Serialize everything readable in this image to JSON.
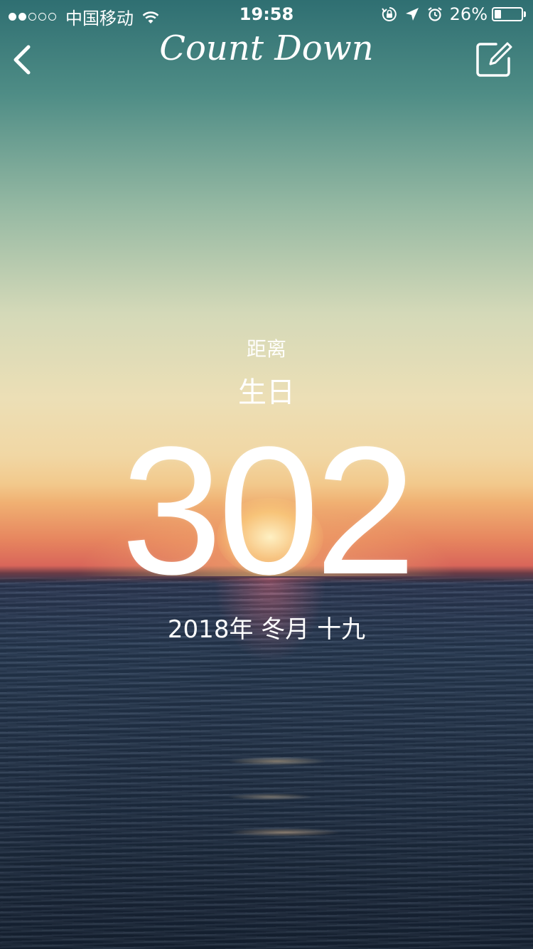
{
  "status_bar": {
    "carrier": "中国移动",
    "time": "19:58",
    "battery_percent_text": "26%",
    "battery_level": 0.26,
    "signal_strength": 2,
    "signal_max": 5
  },
  "nav": {
    "title": "Count Down",
    "back_icon": "chevron-left-icon",
    "edit_icon": "edit-icon"
  },
  "countdown": {
    "prefix": "距离",
    "event": "生日",
    "days": "302",
    "date": "2018年 冬月 十九"
  }
}
